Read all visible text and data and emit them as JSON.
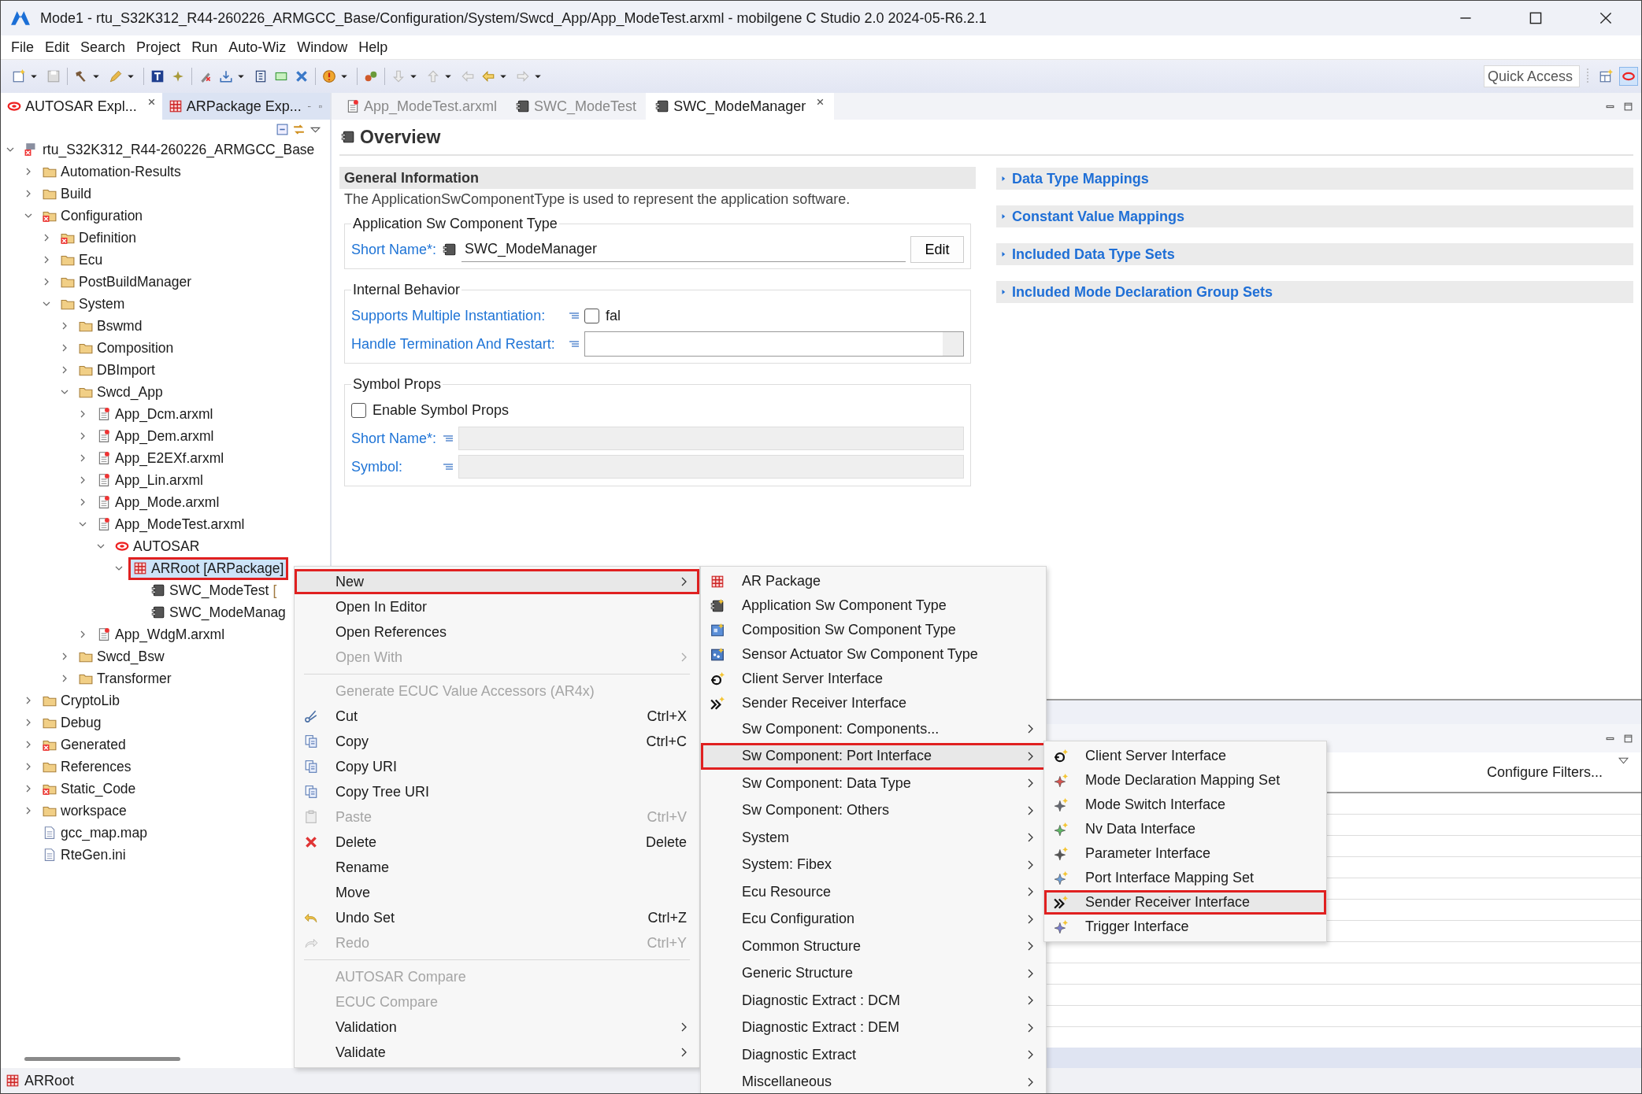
{
  "window": {
    "title": "Mode1 - rtu_S32K312_R44-260226_ARMGCC_Base/Configuration/System/Swcd_App/App_ModeTest.arxml - mobilgene C Studio 2.0 2024-05-R6.2.1"
  },
  "menu_bar": [
    "File",
    "Edit",
    "Search",
    "Project",
    "Run",
    "Auto-Wiz",
    "Window",
    "Help"
  ],
  "quick_access": {
    "placeholder": "Quick Access"
  },
  "explorer": {
    "tabs": [
      {
        "label": "AUTOSAR Expl...",
        "selected": true
      },
      {
        "label": "ARPackage Exp...",
        "selected": false
      }
    ],
    "tree": [
      {
        "kind": "project",
        "label": "rtu_S32K312_R44-260226_ARMGCC_Base",
        "expanded": true,
        "selected": false,
        "children": [
          {
            "kind": "folder",
            "label": "Automation-Results",
            "expanded": false,
            "selected": false
          },
          {
            "kind": "folder",
            "label": "Build",
            "expanded": false,
            "selected": false
          },
          {
            "kind": "folder_error",
            "label": "Configuration",
            "expanded": true,
            "selected": false,
            "children": [
              {
                "kind": "folder_error",
                "label": "Definition",
                "expanded": false,
                "selected": false
              },
              {
                "kind": "folder",
                "label": "Ecu",
                "expanded": false,
                "selected": false
              },
              {
                "kind": "folder",
                "label": "PostBuildManager",
                "expanded": false,
                "selected": false
              },
              {
                "kind": "folder",
                "label": "System",
                "expanded": true,
                "selected": false,
                "children": [
                  {
                    "kind": "folder",
                    "label": "Bswmd",
                    "expanded": false,
                    "selected": false
                  },
                  {
                    "kind": "folder",
                    "label": "Composition",
                    "expanded": false,
                    "selected": false
                  },
                  {
                    "kind": "folder",
                    "label": "DBImport",
                    "expanded": false,
                    "selected": false
                  },
                  {
                    "kind": "folder",
                    "label": "Swcd_App",
                    "expanded": true,
                    "selected": false,
                    "children": [
                      {
                        "kind": "file",
                        "label": "App_Dcm.arxml",
                        "expanded": false,
                        "selected": false
                      },
                      {
                        "kind": "file",
                        "label": "App_Dem.arxml",
                        "expanded": false,
                        "selected": false
                      },
                      {
                        "kind": "file",
                        "label": "App_E2EXf.arxml",
                        "expanded": false,
                        "selected": false
                      },
                      {
                        "kind": "file",
                        "label": "App_Lin.arxml",
                        "expanded": false,
                        "selected": false
                      },
                      {
                        "kind": "file",
                        "label": "App_Mode.arxml",
                        "expanded": false,
                        "selected": false
                      },
                      {
                        "kind": "file",
                        "label": "App_ModeTest.arxml",
                        "expanded": true,
                        "selected": false,
                        "children": [
                          {
                            "kind": "autosar",
                            "label": "AUTOSAR",
                            "expanded": true,
                            "selected": false,
                            "children": [
                              {
                                "kind": "package",
                                "label": "ARRoot [ARPackage]",
                                "expanded": true,
                                "selected": true,
                                "children": [
                                  {
                                    "kind": "component",
                                    "label": "SWC_ModeTest",
                                    "suffix": "[",
                                    "selected": false
                                  },
                                  {
                                    "kind": "component",
                                    "label": "SWC_ModeManag",
                                    "selected": false
                                  }
                                ]
                              }
                            ]
                          }
                        ]
                      },
                      {
                        "kind": "file",
                        "label": "App_WdgM.arxml",
                        "expanded": false,
                        "selected": false
                      }
                    ]
                  },
                  {
                    "kind": "folder",
                    "label": "Swcd_Bsw",
                    "expanded": false,
                    "selected": false
                  },
                  {
                    "kind": "folder",
                    "label": "Transformer",
                    "expanded": false,
                    "selected": false
                  }
                ]
              }
            ]
          },
          {
            "kind": "folder",
            "label": "CryptoLib",
            "expanded": false,
            "selected": false
          },
          {
            "kind": "folder",
            "label": "Debug",
            "expanded": false,
            "selected": false
          },
          {
            "kind": "folder_error",
            "label": "Generated",
            "expanded": false,
            "selected": false
          },
          {
            "kind": "folder",
            "label": "References",
            "expanded": false,
            "selected": false
          },
          {
            "kind": "folder_error",
            "label": "Static_Code",
            "expanded": false,
            "selected": false
          },
          {
            "kind": "folder",
            "label": "workspace",
            "expanded": false,
            "selected": false
          },
          {
            "kind": "plainfile",
            "label": "gcc_map.map",
            "selected": false
          },
          {
            "kind": "plainfile",
            "label": "RteGen.ini",
            "selected": false
          }
        ]
      }
    ]
  },
  "editor": {
    "tabs": [
      {
        "kind": "file",
        "label": "App_ModeTest.arxml",
        "selected": false
      },
      {
        "kind": "component",
        "label": "SWC_ModeTest",
        "selected": false
      },
      {
        "kind": "component",
        "label": "SWC_ModeManager",
        "selected": true
      }
    ],
    "overview": {
      "title": "Overview",
      "general": {
        "title": "General Information",
        "description": "The ApplicationSwComponentType is used to represent the application software."
      },
      "component_type": {
        "title": "Application Sw Component Type",
        "short_name_label": "Short Name*:",
        "short_name": "SWC_ModeManager",
        "edit_button": "Edit"
      },
      "internal_behavior": {
        "title": "Internal Behavior",
        "multiple_instantiation_label": "Supports Multiple Instantiation:",
        "multiple_instantiation": {
          "checked": false,
          "value": "fal"
        },
        "handle_termination_label": "Handle Termination And Restart:"
      },
      "symbol_props": {
        "title": "Symbol Props",
        "enable": {
          "label": "Enable Symbol Props",
          "checked": false
        },
        "short_name_label": "Short Name*:",
        "symbol_label": "Symbol:"
      },
      "sections": [
        {
          "title": "Data Type Mappings",
          "expanded": false
        },
        {
          "title": "Constant Value Mappings",
          "expanded": false
        },
        {
          "title": "Included Data Type Sets",
          "expanded": false
        },
        {
          "title": "Included Mode Declaration Group Sets",
          "expanded": false
        }
      ]
    }
  },
  "bottom_panel": {
    "filter_button": "Configure Filters..."
  },
  "status_bar": {
    "text": "ARRoot"
  },
  "context_menu": {
    "items": [
      {
        "kind": "plain",
        "label": "New",
        "submenu": true,
        "disabled": false,
        "selected": true
      },
      {
        "kind": "plain",
        "label": "Open In Editor",
        "submenu": false,
        "disabled": false,
        "selected": false
      },
      {
        "kind": "plain",
        "label": "Open References",
        "submenu": false,
        "disabled": false,
        "selected": false
      },
      {
        "kind": "plain",
        "label": "Open With",
        "submenu": true,
        "disabled": true,
        "selected": false
      },
      {
        "kind": "separator"
      },
      {
        "kind": "plain",
        "label": "Generate ECUC Value Accessors (AR4x)",
        "submenu": false,
        "disabled": true,
        "selected": false
      },
      {
        "kind": "cut",
        "label": "Cut",
        "shortcut": "Ctrl+X",
        "submenu": false,
        "disabled": false,
        "selected": false
      },
      {
        "kind": "copy",
        "label": "Copy",
        "shortcut": "Ctrl+C",
        "submenu": false,
        "disabled": false,
        "selected": false
      },
      {
        "kind": "copy_uri",
        "label": "Copy URI",
        "submenu": false,
        "disabled": false,
        "selected": false
      },
      {
        "kind": "copy_uri",
        "label": "Copy Tree URI",
        "submenu": false,
        "disabled": false,
        "selected": false
      },
      {
        "kind": "paste",
        "label": "Paste",
        "shortcut": "Ctrl+V",
        "submenu": false,
        "disabled": true,
        "selected": false
      },
      {
        "kind": "delete",
        "label": "Delete",
        "shortcut": "Delete",
        "submenu": false,
        "disabled": false,
        "selected": false
      },
      {
        "kind": "plain",
        "label": "Rename",
        "submenu": false,
        "disabled": false,
        "selected": false
      },
      {
        "kind": "plain",
        "label": "Move",
        "submenu": false,
        "disabled": false,
        "selected": false
      },
      {
        "kind": "undo",
        "label": "Undo Set",
        "shortcut": "Ctrl+Z",
        "submenu": false,
        "disabled": false,
        "selected": false
      },
      {
        "kind": "redo",
        "label": "Redo",
        "shortcut": "Ctrl+Y",
        "submenu": false,
        "disabled": true,
        "selected": false
      },
      {
        "kind": "separator"
      },
      {
        "kind": "plain",
        "label": "AUTOSAR Compare",
        "submenu": false,
        "disabled": true,
        "selected": false
      },
      {
        "kind": "plain",
        "label": "ECUC Compare",
        "submenu": false,
        "disabled": true,
        "selected": false
      },
      {
        "kind": "plain",
        "label": "Validation",
        "submenu": true,
        "disabled": false,
        "selected": false
      },
      {
        "kind": "plain",
        "label": "Validate",
        "submenu": true,
        "disabled": false,
        "selected": false
      }
    ]
  },
  "new_submenu": {
    "items": [
      {
        "kind": "package",
        "label": "AR Package",
        "submenu": false,
        "selected": false
      },
      {
        "kind": "app_component",
        "label": "Application Sw Component Type",
        "submenu": false,
        "selected": false
      },
      {
        "kind": "composition",
        "label": "Composition Sw Component Type",
        "submenu": false,
        "selected": false
      },
      {
        "kind": "sensor",
        "label": "Sensor Actuator Sw Component Type",
        "submenu": false,
        "selected": false
      },
      {
        "kind": "client_server",
        "label": "Client Server Interface",
        "submenu": false,
        "selected": false
      },
      {
        "kind": "sender_receiver",
        "label": "Sender Receiver Interface",
        "submenu": false,
        "selected": false
      },
      {
        "kind": "plain",
        "label": "Sw Component: Components...",
        "submenu": true,
        "selected": false
      },
      {
        "kind": "plain",
        "label": "Sw Component: Port Interface",
        "submenu": true,
        "selected": true
      },
      {
        "kind": "plain",
        "label": "Sw Component: Data Type",
        "submenu": true,
        "selected": false
      },
      {
        "kind": "plain",
        "label": "Sw Component: Others",
        "submenu": true,
        "selected": false
      },
      {
        "kind": "plain",
        "label": "System",
        "submenu": true,
        "selected": false
      },
      {
        "kind": "plain",
        "label": "System: Fibex",
        "submenu": true,
        "selected": false
      },
      {
        "kind": "plain",
        "label": "Ecu Resource",
        "submenu": true,
        "selected": false
      },
      {
        "kind": "plain",
        "label": "Ecu Configuration",
        "submenu": true,
        "selected": false
      },
      {
        "kind": "plain",
        "label": "Common Structure",
        "submenu": true,
        "selected": false
      },
      {
        "kind": "plain",
        "label": "Generic Structure",
        "submenu": true,
        "selected": false
      },
      {
        "kind": "plain",
        "label": "Diagnostic Extract : DCM",
        "submenu": true,
        "selected": false
      },
      {
        "kind": "plain",
        "label": "Diagnostic Extract : DEM",
        "submenu": true,
        "selected": false
      },
      {
        "kind": "plain",
        "label": "Diagnostic Extract",
        "submenu": true,
        "selected": false
      },
      {
        "kind": "plain",
        "label": "Miscellaneous",
        "submenu": true,
        "selected": false
      }
    ]
  },
  "port_interface_submenu": {
    "items": [
      {
        "kind": "client_server",
        "label": "Client Server Interface",
        "selected": false
      },
      {
        "kind": "mapping",
        "label": "Mode Declaration Mapping Set",
        "selected": false
      },
      {
        "kind": "mode_switch",
        "label": "Mode Switch Interface",
        "selected": false
      },
      {
        "kind": "nv_data",
        "label": "Nv Data Interface",
        "selected": false
      },
      {
        "kind": "parameter",
        "label": "Parameter Interface",
        "selected": false
      },
      {
        "kind": "port_mapping",
        "label": "Port Interface Mapping Set",
        "selected": false
      },
      {
        "kind": "sender_receiver",
        "label": "Sender Receiver Interface",
        "selected": true
      },
      {
        "kind": "trigger",
        "label": "Trigger Interface",
        "selected": false
      }
    ]
  }
}
